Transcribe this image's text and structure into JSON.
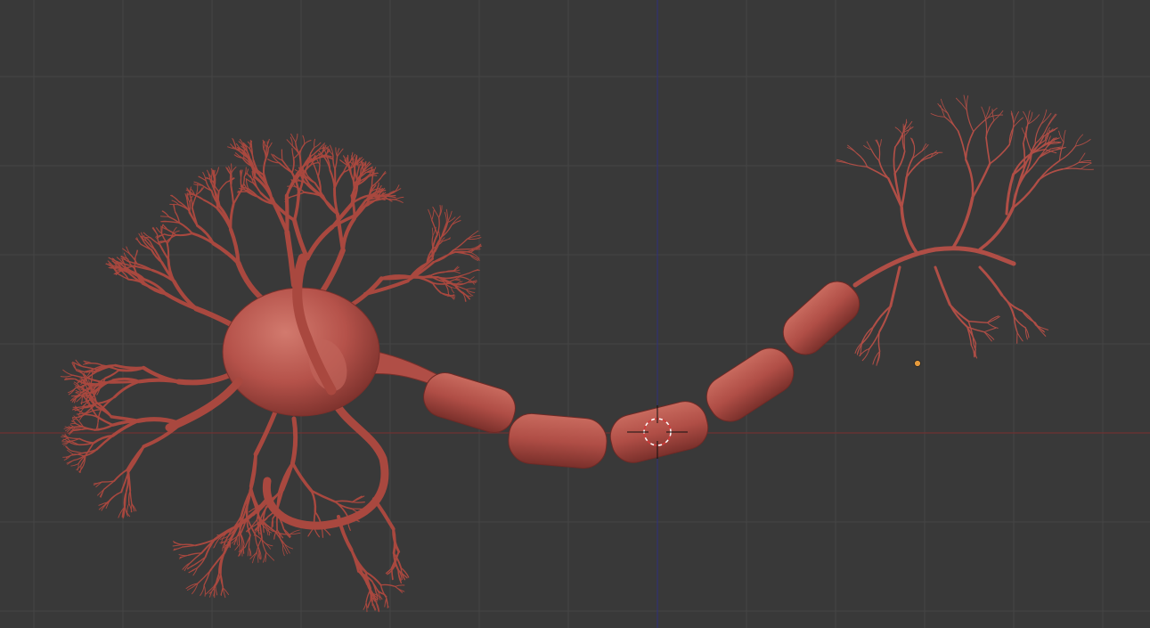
{
  "viewport": {
    "kind": "3D viewport (front orthographic)",
    "background_color": "#393939",
    "grid_color": "#454545",
    "x_axis_color": "#7a2f2f",
    "z_axis_color": "#2f2f7a",
    "show_grid": true
  },
  "scene": {
    "object": "neuron",
    "material_color": "#b5524a",
    "material_dark": "#6e2a26",
    "material_light": "#d27a6e",
    "parts": [
      "dendrite-tree",
      "cell-body",
      "axon-hillock",
      "myelin-sheath-segments",
      "axon-terminal"
    ],
    "myelin_segment_count": 5
  },
  "gizmos": {
    "cursor_3d": "3d-cursor-icon",
    "origin_dot": "object-origin-icon",
    "origin_color": "#e59a3c"
  }
}
